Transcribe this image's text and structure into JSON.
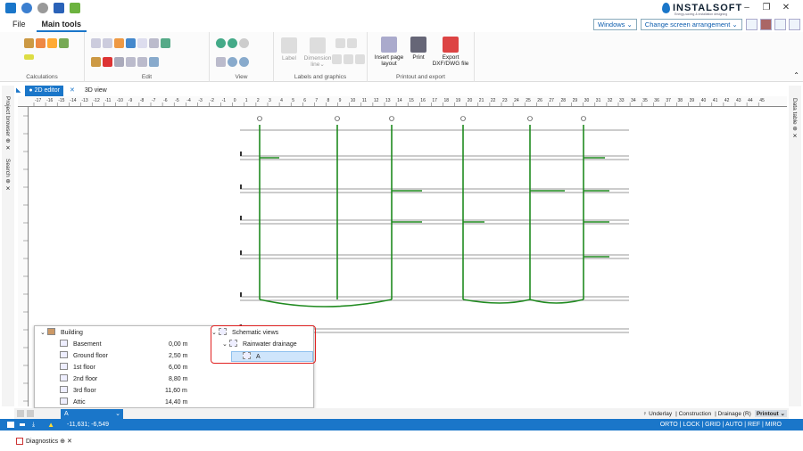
{
  "quick_access": [
    "home-icon",
    "undo-icon",
    "redo-icon",
    "save-icon",
    "export-icon"
  ],
  "brand": {
    "name": "INSTALSOFT",
    "tagline": "Energy-saving & installation designing"
  },
  "window_controls": [
    "–",
    "❐",
    "✕"
  ],
  "menu": {
    "items": [
      "File",
      "Main tools"
    ],
    "active": "Main tools",
    "windows_dd": "Windows ⌄",
    "arrangement_dd": "Change screen arrangement ⌄"
  },
  "ribbon": {
    "groups": [
      "Calculations",
      "Edit",
      "View",
      "Labels and graphics",
      "Printout and export"
    ],
    "label_btn": "Label",
    "dimension_btn": "Dimension line⌄",
    "insert_page_layout": "Insert page layout",
    "print": "Print",
    "export": "Export DXF/DWG file"
  },
  "tabs": {
    "editor": "● 2D editor",
    "view3d": "3D view"
  },
  "side": {
    "left1": "Project browser ⊕ ✕",
    "left2": "Search ⊕ ✕",
    "right": "Data table ⊕ ✕"
  },
  "ruler": {
    "ticks": [
      "-17",
      "-16",
      "-15",
      "-14",
      "-13",
      "-12",
      "-11",
      "-10",
      "-9",
      "-8",
      "-7",
      "-6",
      "-5",
      "-4",
      "-3",
      "-2",
      "-1",
      "0",
      "1",
      "2",
      "3",
      "4",
      "5",
      "6",
      "7",
      "8",
      "9",
      "10",
      "11",
      "12",
      "13",
      "14",
      "15",
      "16",
      "17",
      "18",
      "19",
      "20",
      "21",
      "22",
      "23",
      "24",
      "25",
      "26",
      "27",
      "28",
      "29",
      "30",
      "31",
      "32",
      "33",
      "34",
      "35",
      "36",
      "37",
      "38",
      "39",
      "40",
      "41",
      "42",
      "43",
      "44",
      "45"
    ]
  },
  "tree": {
    "root": "Building",
    "floors": [
      {
        "name": "Basement",
        "level": "0,00 m"
      },
      {
        "name": "Ground floor",
        "level": "2,50 m"
      },
      {
        "name": "1st floor",
        "level": "6,00 m"
      },
      {
        "name": "2nd floor",
        "level": "8,80 m"
      },
      {
        "name": "3rd floor",
        "level": "11,60 m"
      },
      {
        "name": "Attic",
        "level": "14,40 m"
      }
    ],
    "schematic_root": "Schematic views",
    "schematic_child": "Rainwater drainage",
    "schematic_leaf": "A"
  },
  "bottom": {
    "selected_view": "A",
    "toggles": [
      "Underlay",
      "Construction",
      "Drainage (R)",
      "Printout"
    ]
  },
  "status": {
    "coords": "-11,631; -6,549",
    "modes": "ORTO | LOCK | GRID | AUTO | REF | MIRO"
  },
  "diagnostics": "Diagnostics ⊕ ✕",
  "colors": {
    "accent": "#1a76c9",
    "pipe": "#1f8a1f",
    "highlight": "#e02020"
  }
}
